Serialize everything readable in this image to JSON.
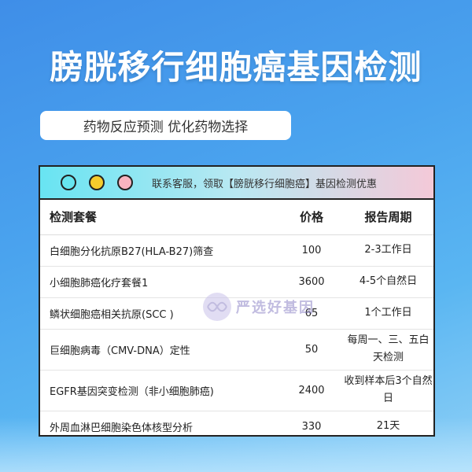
{
  "headline": "膀胱移行细胞癌基因检测",
  "subtitle": "药物反应预测 优化药物选择",
  "card": {
    "header_text": "联系客服，领取【膀胱移行细胞癌】基因检测优惠",
    "columns": [
      "检测套餐",
      "价格",
      "报告周期"
    ],
    "rows": [
      {
        "name": "白细胞分化抗原B27(HLA-B27)筛查",
        "price": "100",
        "period": "2-3工作日"
      },
      {
        "name": "小细胞肺癌化疗套餐1",
        "price": "3600",
        "period": "4-5个自然日"
      },
      {
        "name": "鳞状细胞癌相关抗原(SCC )",
        "price": "65",
        "period": "1个工作日"
      },
      {
        "name": "巨细胞病毒（CMV-DNA）定性",
        "price": "50",
        "period": "每周一、三、五白天检测"
      },
      {
        "name": "EGFR基因突变检测（非小细胞肺癌)",
        "price": "2400",
        "period": "收到样本后3个自然日"
      },
      {
        "name": "外周血淋巴细胞染色体核型分析",
        "price": "330",
        "period": "21天"
      }
    ]
  },
  "watermark": "严选好基因",
  "colors": {
    "background": "#4aa3ee",
    "header_gradient_start": "#68e4f2",
    "header_gradient_end": "#f4c9d8"
  }
}
